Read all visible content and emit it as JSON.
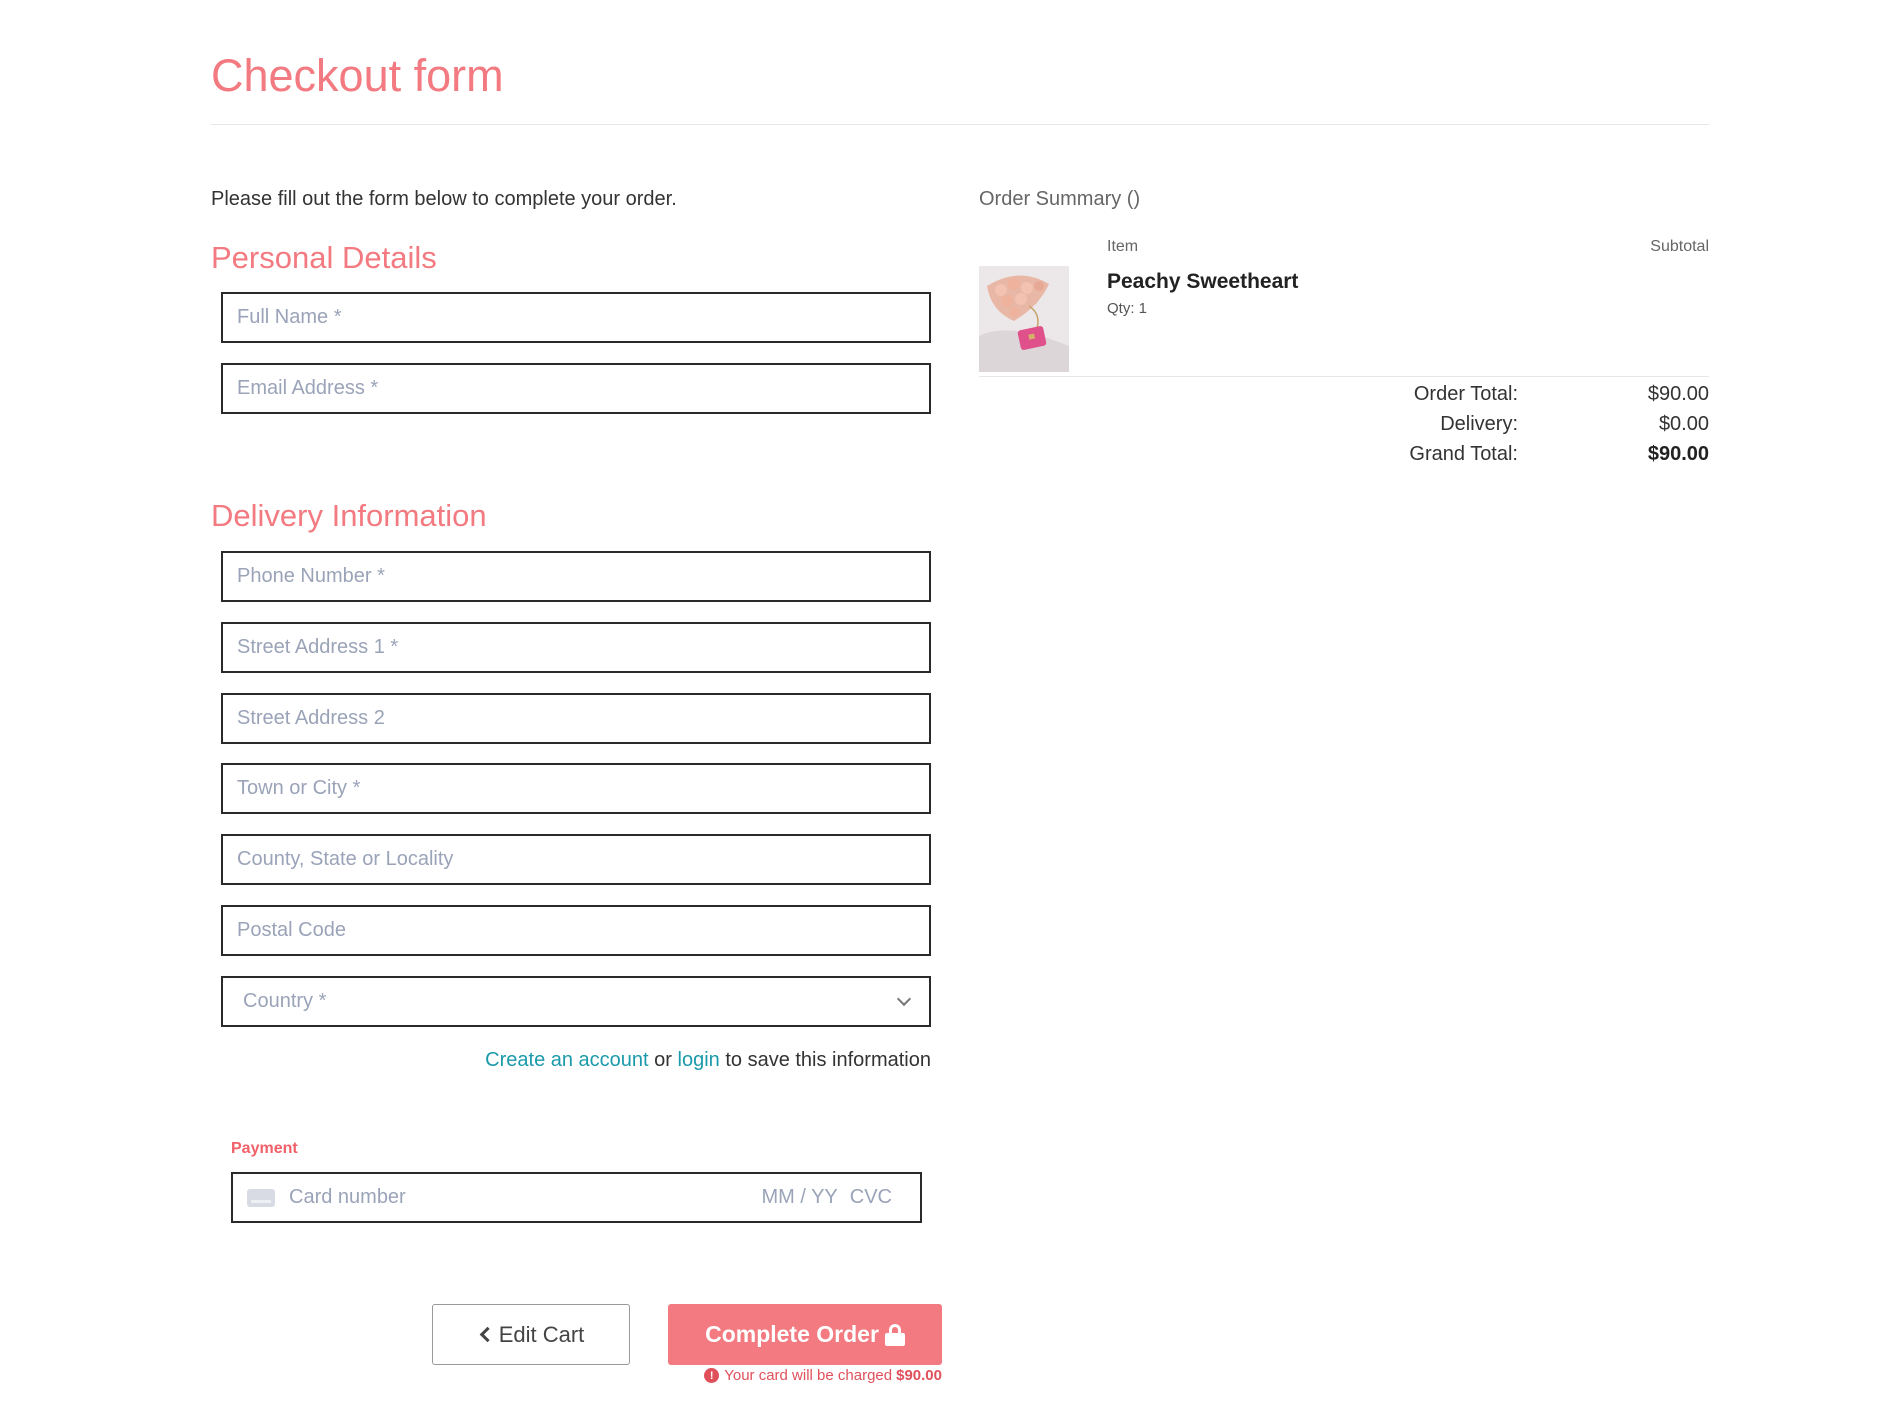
{
  "page": {
    "title": "Checkout form",
    "intro": "Please fill out the form below to complete your order."
  },
  "personal": {
    "heading": "Personal Details",
    "full_name_placeholder": "Full Name *",
    "email_placeholder": "Email Address *"
  },
  "delivery": {
    "heading": "Delivery Information",
    "phone_placeholder": "Phone Number *",
    "street1_placeholder": "Street Address 1 *",
    "street2_placeholder": "Street Address 2",
    "town_placeholder": "Town or City *",
    "county_placeholder": "County, State or Locality",
    "postal_placeholder": "Postal Code",
    "country_selected": "Country *"
  },
  "account": {
    "create_link": "Create an account",
    "or_text": " or ",
    "login_link": "login",
    "suffix": " to save this information"
  },
  "payment": {
    "label": "Payment",
    "card_placeholder": "Card number",
    "exp_placeholder": "MM / YY",
    "cvc_placeholder": "CVC"
  },
  "actions": {
    "edit_cart_label": "Edit Cart",
    "complete_label": "Complete Order",
    "charge_note": "Your card will be charged",
    "charge_amount": "$90.00"
  },
  "summary": {
    "title": "Order Summary ()",
    "col_item": "Item",
    "col_subtotal": "Subtotal",
    "items": [
      {
        "name": "Peachy Sweetheart",
        "qty": "Qty: 1"
      }
    ],
    "order_total_label": "Order Total:",
    "order_total_value": "$90.00",
    "delivery_label": "Delivery:",
    "delivery_value": "$0.00",
    "grand_total_label": "Grand Total:",
    "grand_total_value": "$90.00"
  },
  "colors": {
    "accent": "#f27a80",
    "link": "#1b9aaa",
    "error": "#e0505b"
  }
}
